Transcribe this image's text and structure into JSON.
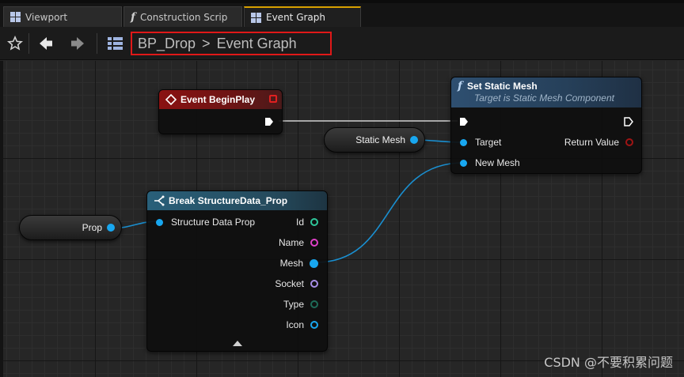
{
  "tabs": [
    {
      "label": "Viewport",
      "icon": "viewport-grid-icon",
      "active": false
    },
    {
      "label": "Construction Scrip",
      "icon": "function-icon",
      "active": false
    },
    {
      "label": "Event Graph",
      "icon": "event-graph-grid-icon",
      "active": true
    }
  ],
  "toolbar": {
    "breadcrumb": {
      "blueprint": "BP_Drop",
      "separator": ">",
      "graph": "Event Graph"
    },
    "highlight_color": "#e01818"
  },
  "nodes": {
    "event_begin_play": {
      "title": "Event BeginPlay",
      "header_color": "#8a1212"
    },
    "set_static_mesh": {
      "title": "Set Static Mesh",
      "subtitle": "Target is Static Mesh Component",
      "inputs": [
        "Target",
        "New Mesh"
      ],
      "outputs": [
        "Return Value"
      ],
      "header_color": "#2e4f70"
    },
    "static_mesh_var": {
      "label": "Static Mesh"
    },
    "prop_var": {
      "label": "Prop"
    },
    "break_struct": {
      "title": "Break StructureData_Prop",
      "input": "Structure Data Prop",
      "outputs": [
        {
          "label": "Id",
          "color": "#2ec79a"
        },
        {
          "label": "Name",
          "color": "#e040c8"
        },
        {
          "label": "Mesh",
          "color": "#18a7f0"
        },
        {
          "label": "Socket",
          "color": "#a88ee8"
        },
        {
          "label": "Type",
          "color": "#1e6b58"
        },
        {
          "label": "Icon",
          "color": "#18a7f0"
        }
      ],
      "header_color": "#29607a"
    }
  },
  "colors": {
    "object_pin": "#18a7f0",
    "wire": "#1a8fd0",
    "return_pin": "#a01414",
    "exec_wire": "#cfcfcf"
  },
  "watermark": "CSDN @不要积累问题"
}
